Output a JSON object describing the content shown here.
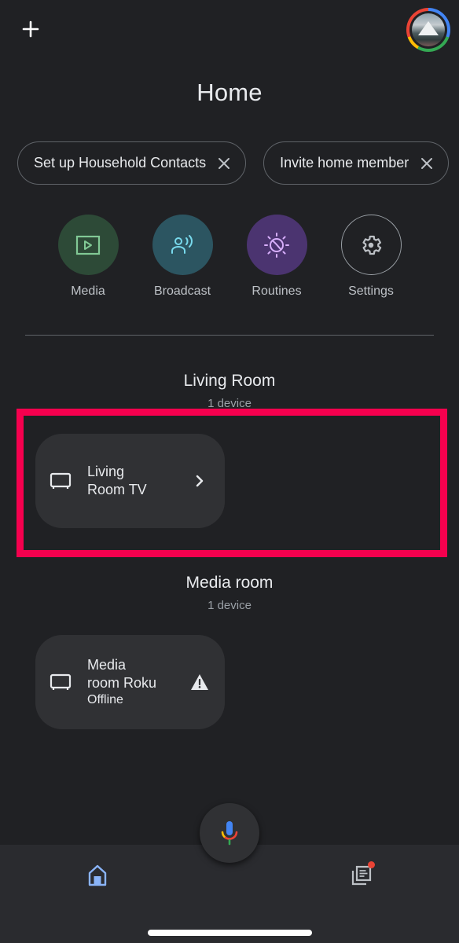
{
  "header": {
    "add_icon": "plus-icon",
    "avatar_icon": "account-avatar",
    "title": "Home"
  },
  "chips": [
    {
      "label": "Set up Household Contacts",
      "icon": "close-icon"
    },
    {
      "label": "Invite home member",
      "icon": "close-icon"
    }
  ],
  "quick_actions": [
    {
      "label": "Media",
      "icon": "media-play-icon",
      "bg": "#2d4a37",
      "fg": "#81c995"
    },
    {
      "label": "Broadcast",
      "icon": "broadcast-icon",
      "bg": "#2c5561",
      "fg": "#78d9ec"
    },
    {
      "label": "Routines",
      "icon": "routines-icon",
      "bg": "#4b3470",
      "fg": "#d7aefb"
    },
    {
      "label": "Settings",
      "icon": "gear-icon",
      "bg": "transparent",
      "fg": "#bdc1c6"
    }
  ],
  "rooms": [
    {
      "name": "Living Room",
      "count": "1 device",
      "highlighted": true,
      "devices": [
        {
          "name_line1": "Living",
          "name_line2": "Room TV",
          "status": "",
          "icon": "tv-icon",
          "trail_icon": "chevron-right-icon"
        }
      ]
    },
    {
      "name": "Media room",
      "count": "1 device",
      "highlighted": false,
      "devices": [
        {
          "name_line1": "Media",
          "name_line2": "room Roku",
          "status": "Offline",
          "icon": "tv-icon",
          "trail_icon": "warning-icon"
        }
      ]
    }
  ],
  "bottom_nav": {
    "home_icon": "home-icon",
    "mic_icon": "google-assistant-mic-icon",
    "feed_icon": "feed-icon",
    "feed_has_notification": true
  },
  "colors": {
    "background": "#202124",
    "card": "#303134",
    "highlight": "#f5004e",
    "active_nav": "#8ab4f8"
  }
}
